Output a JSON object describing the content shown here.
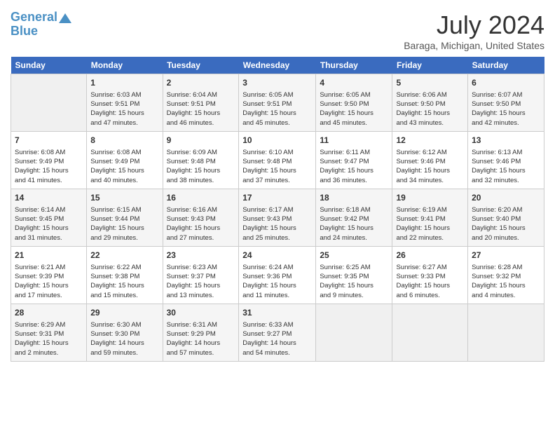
{
  "header": {
    "logo_line1": "General",
    "logo_line2": "Blue",
    "month": "July 2024",
    "location": "Baraga, Michigan, United States"
  },
  "weekdays": [
    "Sunday",
    "Monday",
    "Tuesday",
    "Wednesday",
    "Thursday",
    "Friday",
    "Saturday"
  ],
  "weeks": [
    [
      {
        "day": "",
        "info": ""
      },
      {
        "day": "1",
        "info": "Sunrise: 6:03 AM\nSunset: 9:51 PM\nDaylight: 15 hours\nand 47 minutes."
      },
      {
        "day": "2",
        "info": "Sunrise: 6:04 AM\nSunset: 9:51 PM\nDaylight: 15 hours\nand 46 minutes."
      },
      {
        "day": "3",
        "info": "Sunrise: 6:05 AM\nSunset: 9:51 PM\nDaylight: 15 hours\nand 45 minutes."
      },
      {
        "day": "4",
        "info": "Sunrise: 6:05 AM\nSunset: 9:50 PM\nDaylight: 15 hours\nand 45 minutes."
      },
      {
        "day": "5",
        "info": "Sunrise: 6:06 AM\nSunset: 9:50 PM\nDaylight: 15 hours\nand 43 minutes."
      },
      {
        "day": "6",
        "info": "Sunrise: 6:07 AM\nSunset: 9:50 PM\nDaylight: 15 hours\nand 42 minutes."
      }
    ],
    [
      {
        "day": "7",
        "info": "Sunrise: 6:08 AM\nSunset: 9:49 PM\nDaylight: 15 hours\nand 41 minutes."
      },
      {
        "day": "8",
        "info": "Sunrise: 6:08 AM\nSunset: 9:49 PM\nDaylight: 15 hours\nand 40 minutes."
      },
      {
        "day": "9",
        "info": "Sunrise: 6:09 AM\nSunset: 9:48 PM\nDaylight: 15 hours\nand 38 minutes."
      },
      {
        "day": "10",
        "info": "Sunrise: 6:10 AM\nSunset: 9:48 PM\nDaylight: 15 hours\nand 37 minutes."
      },
      {
        "day": "11",
        "info": "Sunrise: 6:11 AM\nSunset: 9:47 PM\nDaylight: 15 hours\nand 36 minutes."
      },
      {
        "day": "12",
        "info": "Sunrise: 6:12 AM\nSunset: 9:46 PM\nDaylight: 15 hours\nand 34 minutes."
      },
      {
        "day": "13",
        "info": "Sunrise: 6:13 AM\nSunset: 9:46 PM\nDaylight: 15 hours\nand 32 minutes."
      }
    ],
    [
      {
        "day": "14",
        "info": "Sunrise: 6:14 AM\nSunset: 9:45 PM\nDaylight: 15 hours\nand 31 minutes."
      },
      {
        "day": "15",
        "info": "Sunrise: 6:15 AM\nSunset: 9:44 PM\nDaylight: 15 hours\nand 29 minutes."
      },
      {
        "day": "16",
        "info": "Sunrise: 6:16 AM\nSunset: 9:43 PM\nDaylight: 15 hours\nand 27 minutes."
      },
      {
        "day": "17",
        "info": "Sunrise: 6:17 AM\nSunset: 9:43 PM\nDaylight: 15 hours\nand 25 minutes."
      },
      {
        "day": "18",
        "info": "Sunrise: 6:18 AM\nSunset: 9:42 PM\nDaylight: 15 hours\nand 24 minutes."
      },
      {
        "day": "19",
        "info": "Sunrise: 6:19 AM\nSunset: 9:41 PM\nDaylight: 15 hours\nand 22 minutes."
      },
      {
        "day": "20",
        "info": "Sunrise: 6:20 AM\nSunset: 9:40 PM\nDaylight: 15 hours\nand 20 minutes."
      }
    ],
    [
      {
        "day": "21",
        "info": "Sunrise: 6:21 AM\nSunset: 9:39 PM\nDaylight: 15 hours\nand 17 minutes."
      },
      {
        "day": "22",
        "info": "Sunrise: 6:22 AM\nSunset: 9:38 PM\nDaylight: 15 hours\nand 15 minutes."
      },
      {
        "day": "23",
        "info": "Sunrise: 6:23 AM\nSunset: 9:37 PM\nDaylight: 15 hours\nand 13 minutes."
      },
      {
        "day": "24",
        "info": "Sunrise: 6:24 AM\nSunset: 9:36 PM\nDaylight: 15 hours\nand 11 minutes."
      },
      {
        "day": "25",
        "info": "Sunrise: 6:25 AM\nSunset: 9:35 PM\nDaylight: 15 hours\nand 9 minutes."
      },
      {
        "day": "26",
        "info": "Sunrise: 6:27 AM\nSunset: 9:33 PM\nDaylight: 15 hours\nand 6 minutes."
      },
      {
        "day": "27",
        "info": "Sunrise: 6:28 AM\nSunset: 9:32 PM\nDaylight: 15 hours\nand 4 minutes."
      }
    ],
    [
      {
        "day": "28",
        "info": "Sunrise: 6:29 AM\nSunset: 9:31 PM\nDaylight: 15 hours\nand 2 minutes."
      },
      {
        "day": "29",
        "info": "Sunrise: 6:30 AM\nSunset: 9:30 PM\nDaylight: 14 hours\nand 59 minutes."
      },
      {
        "day": "30",
        "info": "Sunrise: 6:31 AM\nSunset: 9:29 PM\nDaylight: 14 hours\nand 57 minutes."
      },
      {
        "day": "31",
        "info": "Sunrise: 6:33 AM\nSunset: 9:27 PM\nDaylight: 14 hours\nand 54 minutes."
      },
      {
        "day": "",
        "info": ""
      },
      {
        "day": "",
        "info": ""
      },
      {
        "day": "",
        "info": ""
      }
    ]
  ]
}
